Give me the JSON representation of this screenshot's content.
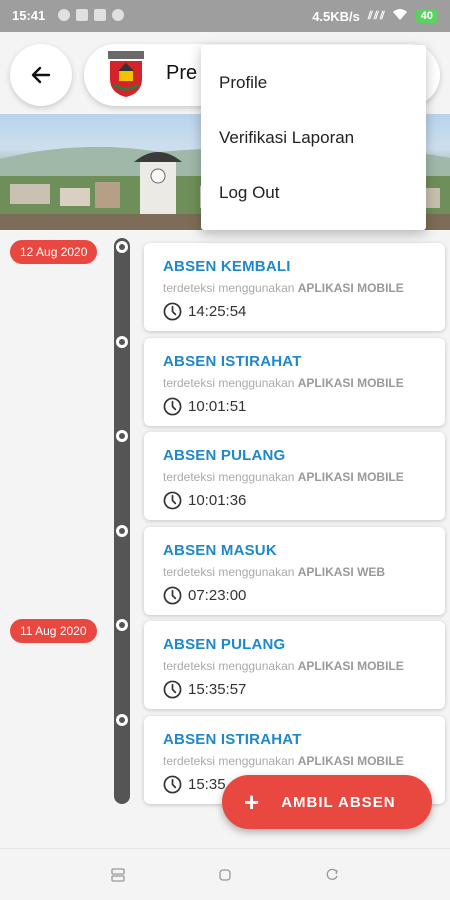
{
  "status_bar": {
    "time": "15:41",
    "speed": "4.5KB/s",
    "battery": "40"
  },
  "header": {
    "title": "Pre",
    "back_icon": "arrow-left-icon",
    "logo": "regional-emblem"
  },
  "menu": {
    "items": [
      {
        "label": "Profile"
      },
      {
        "label": "Verifikasi Laporan"
      },
      {
        "label": "Log Out"
      }
    ]
  },
  "timeline": {
    "dates": [
      {
        "label": "12 Aug 2020"
      },
      {
        "label": "11 Aug 2020"
      }
    ],
    "entries": [
      {
        "title": "ABSEN KEMBALI",
        "detected_prefix": "terdeteksi menggunakan",
        "source": "APLIKASI MOBILE",
        "time": "14:25:54"
      },
      {
        "title": "ABSEN ISTIRAHAT",
        "detected_prefix": "terdeteksi menggunakan",
        "source": "APLIKASI MOBILE",
        "time": "10:01:51"
      },
      {
        "title": "ABSEN PULANG",
        "detected_prefix": "terdeteksi menggunakan",
        "source": "APLIKASI MOBILE",
        "time": "10:01:36"
      },
      {
        "title": "ABSEN MASUK",
        "detected_prefix": "terdeteksi menggunakan",
        "source": "APLIKASI WEB",
        "time": "07:23:00"
      },
      {
        "title": "ABSEN PULANG",
        "detected_prefix": "terdeteksi menggunakan",
        "source": "APLIKASI MOBILE",
        "time": "15:35:57"
      },
      {
        "title": "ABSEN ISTIRAHAT",
        "detected_prefix": "terdeteksi menggunakan",
        "source": "APLIKASI MOBILE",
        "time": "15:35"
      }
    ]
  },
  "fab": {
    "icon": "plus-icon",
    "label": "AMBIL ABSEN"
  },
  "colors": {
    "accent_red": "#e8483f",
    "title_blue": "#1e88c8",
    "timeline_gray": "#555555"
  }
}
